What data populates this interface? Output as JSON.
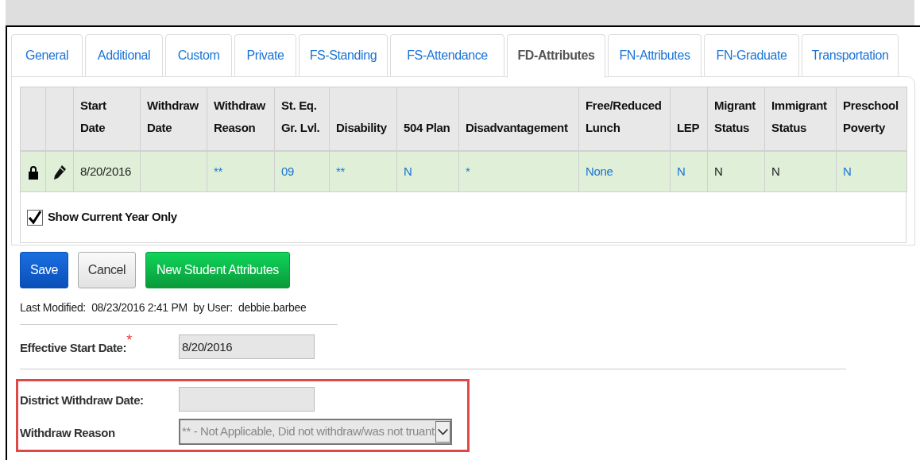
{
  "tabs": [
    {
      "label": "General",
      "selected": false
    },
    {
      "label": "Additional",
      "selected": false
    },
    {
      "label": "Custom",
      "selected": false
    },
    {
      "label": "Private",
      "selected": false
    },
    {
      "label": "FS-Standing",
      "selected": false
    },
    {
      "label": "FS-Attendance",
      "selected": false
    },
    {
      "label": "FD-Attributes",
      "selected": true
    },
    {
      "label": "FN-Attributes",
      "selected": false
    },
    {
      "label": "FN-Graduate",
      "selected": false
    },
    {
      "label": "Transportation",
      "selected": false
    }
  ],
  "table": {
    "columns": [
      "Start Date",
      "Withdraw Date",
      "Withdraw Reason",
      "St. Eq. Gr. Lvl.",
      "Disability",
      "504 Plan",
      "Disadvantagement",
      "Free/Reduced Lunch",
      "LEP",
      "Migrant Status",
      "Immigrant Status",
      "Preschool Poverty"
    ],
    "rows": [
      {
        "locked": true,
        "cells": [
          {
            "text": "8/20/2016",
            "link": false
          },
          {
            "text": ""
          },
          {
            "text": "**",
            "link": true
          },
          {
            "text": "09",
            "link": true
          },
          {
            "text": "**",
            "link": true
          },
          {
            "text": "N",
            "link": true
          },
          {
            "text": "*",
            "link": true
          },
          {
            "text": "None",
            "link": true
          },
          {
            "text": "N",
            "link": true
          },
          {
            "text": "N",
            "link": false
          },
          {
            "text": "N",
            "link": false
          },
          {
            "text": "N",
            "link": true
          }
        ]
      }
    ]
  },
  "show_current_year_only": {
    "label": "Show Current Year Only",
    "checked": true
  },
  "buttons": [
    {
      "label": "Save",
      "kind": "primary"
    },
    {
      "label": "Cancel",
      "kind": "default"
    },
    {
      "label": "New Student Attributes",
      "kind": "success"
    }
  ],
  "last_modified": "Last Modified:  08/23/2016 2:41 PM  by User:  debbie.barbee",
  "form": [
    {
      "label": "Effective Start Date:$^{*}$",
      "kind": "text",
      "value": "8/20/2016",
      "highlighted": false
    },
    {
      "label": "District Withdraw Date:",
      "kind": "text",
      "highlighted": true
    },
    {
      "label": "Withdraw Reason",
      "kind": "select",
      "value": "** - Not Applicable, Did not withdraw/was not truant",
      "highlighted": true
    }
  ]
}
